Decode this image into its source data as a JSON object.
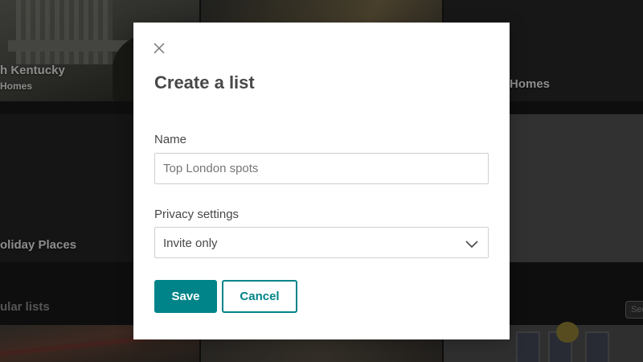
{
  "background": {
    "tiles": [
      {
        "title": "h Kentucky",
        "subtitle": "Homes"
      },
      {
        "title": "",
        "subtitle": ""
      },
      {
        "title": "Homes",
        "subtitle": ""
      },
      {
        "title": "oliday Places",
        "subtitle": ""
      }
    ],
    "section_title": "ular lists",
    "see_all": "See"
  },
  "modal": {
    "title": "Create a list",
    "close_icon": "close-icon",
    "name_label": "Name",
    "name_placeholder": "Top London spots",
    "name_value": "",
    "privacy_label": "Privacy settings",
    "privacy_value": "Invite only",
    "save_label": "Save",
    "cancel_label": "Cancel"
  },
  "colors": {
    "accent": "#008489",
    "overlay": "#000000",
    "text": "#484848"
  }
}
